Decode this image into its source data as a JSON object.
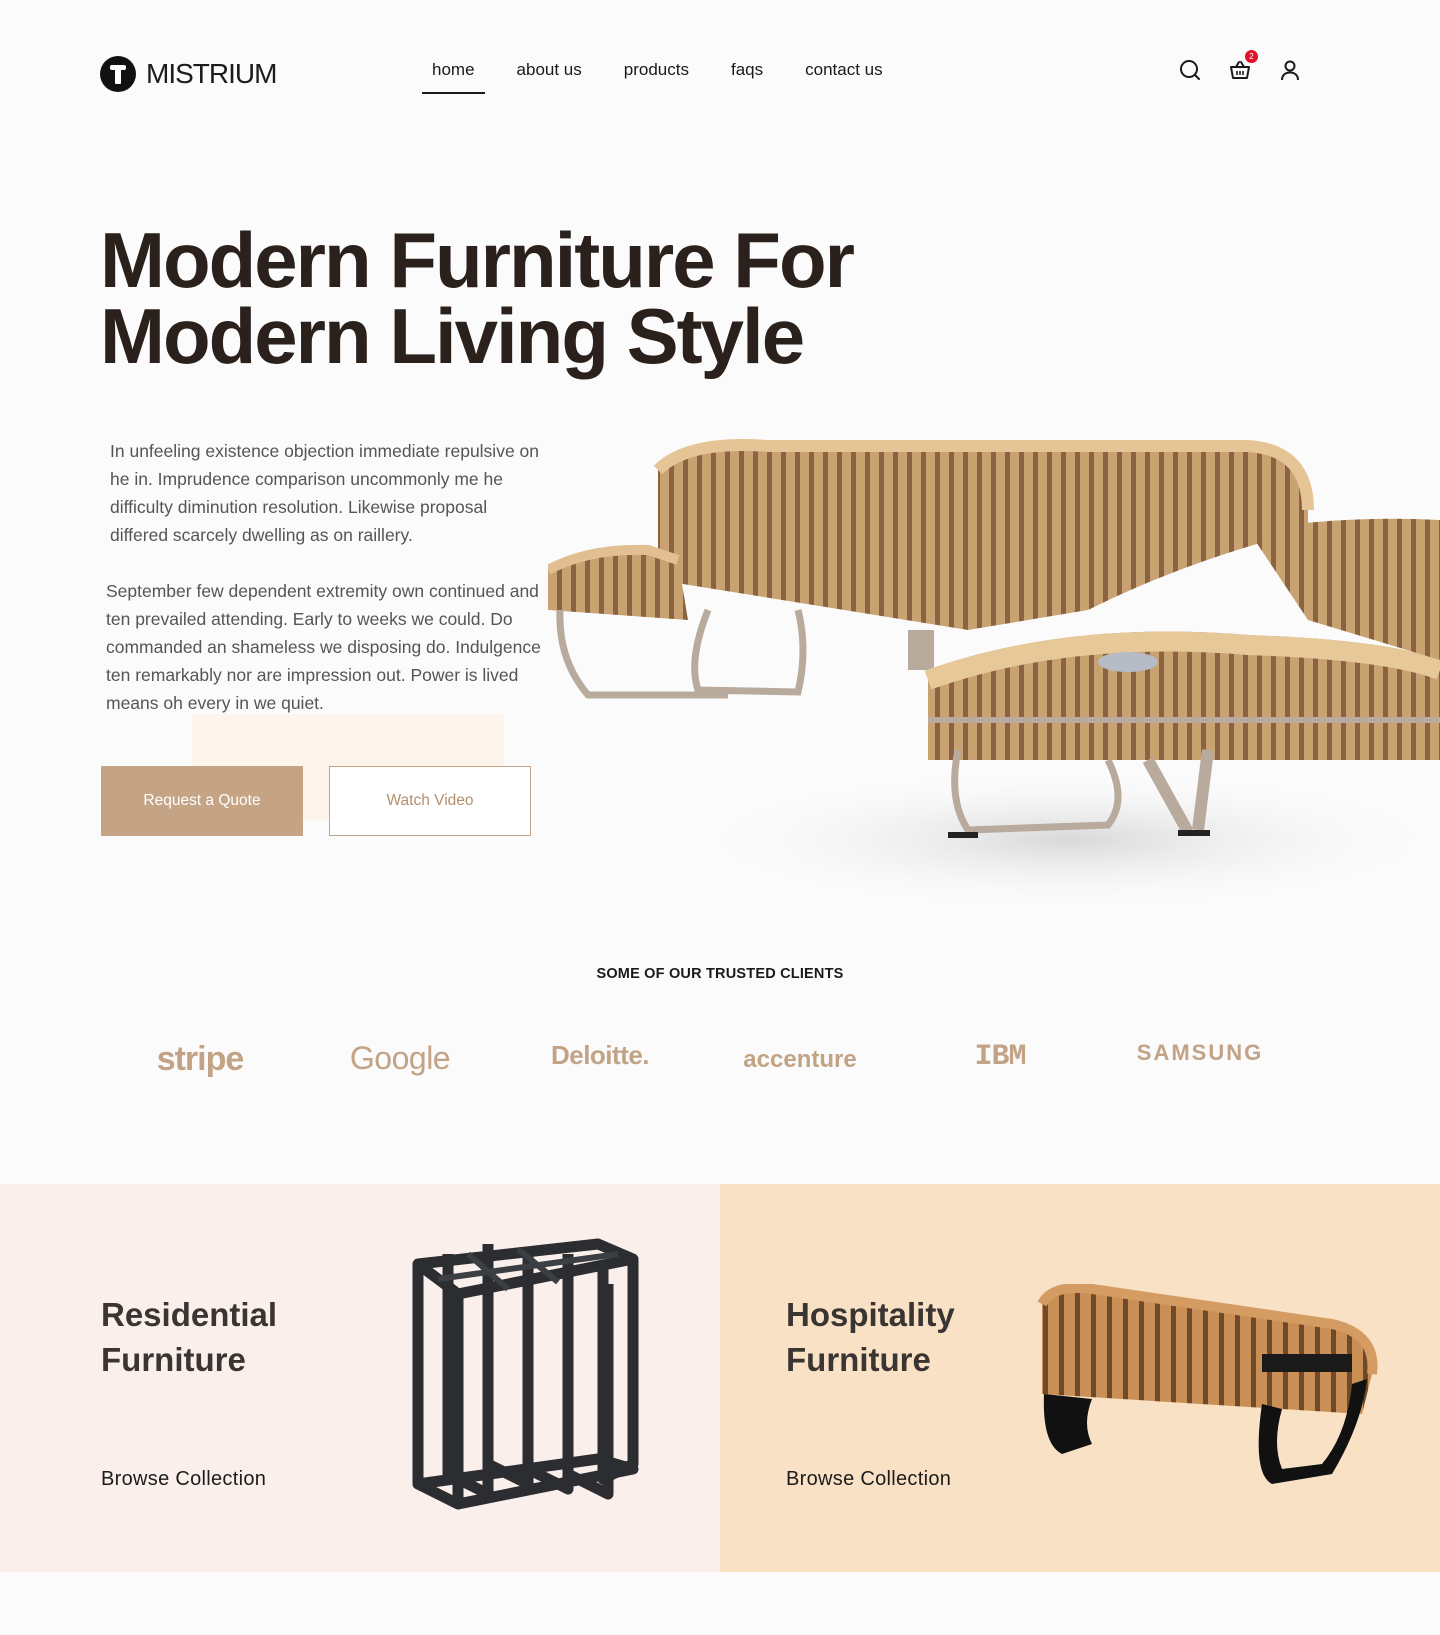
{
  "brand": {
    "name": "MISTRIUM"
  },
  "nav": {
    "items": [
      "home",
      "about us",
      "products",
      "faqs",
      "contact us"
    ],
    "active": "home"
  },
  "header_icons": {
    "search": "search-icon",
    "cart": "cart-icon",
    "cart_count": "2",
    "user": "user-icon"
  },
  "hero": {
    "title_line1": "Modern Furniture For",
    "title_line2": "Modern Living Style",
    "paragraph1": "In unfeeling existence objection immediate repulsive on he in. Imprudence comparison uncommonly me he difficulty diminution resolution. Likewise proposal differed scarcely dwelling as on raillery.",
    "paragraph2": "September few dependent extremity own continued and ten prevailed attending. Early to weeks we could. Do commanded an shameless we disposing do. Indulgence ten remarkably nor are impression out. Power is lived means oh every in we quiet.",
    "primary_button": "Request a Quote",
    "secondary_button": "Watch Video"
  },
  "clients": {
    "title": "SOME OF OUR TRUSTED CLIENTS",
    "logos": [
      "stripe",
      "Google",
      "Deloitte.",
      "accenture",
      "IBM",
      "SAMSUNG"
    ]
  },
  "categories": [
    {
      "title_line1": "Residential",
      "title_line2": "Furniture",
      "link": "Browse Collection"
    },
    {
      "title_line1": "Hospitality",
      "title_line2": "Furniture",
      "link": "Browse Collection"
    }
  ],
  "colors": {
    "accent": "#c4a485",
    "residential_bg": "#fbefec",
    "hospitality_bg": "#f9e1c5",
    "badge": "#e0112b"
  }
}
